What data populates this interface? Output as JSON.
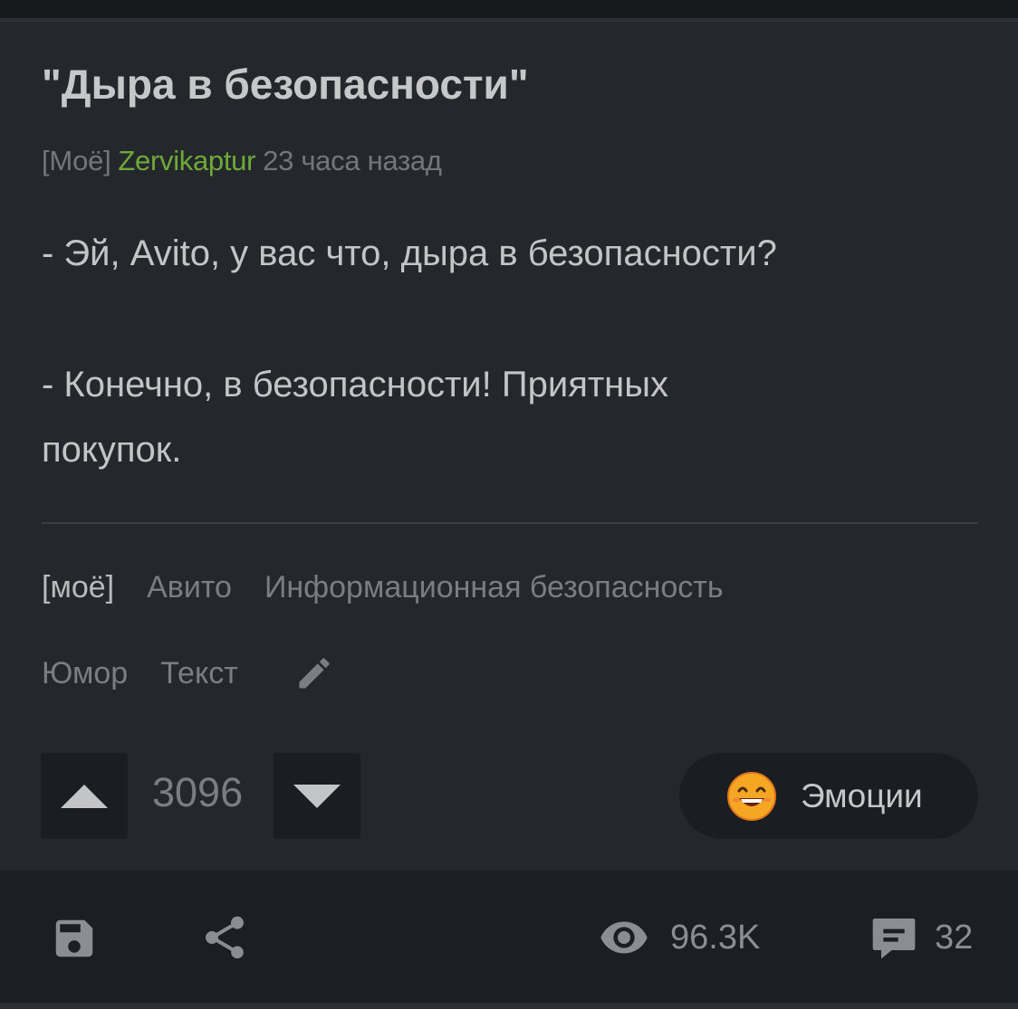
{
  "post": {
    "title": "\"Дыра в безопасности\"",
    "community": "[Моё]",
    "author": "Zervikaptur",
    "time": "23 часа назад",
    "body_lines": [
      "- Эй, Avito, у вас что, дыра в безопасности?",
      "- Конечно, в безопасности! Приятных",
      "покупок."
    ]
  },
  "tags": {
    "row1": [
      "[моё]",
      "Авито",
      "Информационная безопасность"
    ],
    "row2": [
      "Юмор",
      "Текст"
    ]
  },
  "votes": {
    "score": "3096"
  },
  "emotions": {
    "label": "Эмоции"
  },
  "stats": {
    "views": "96.3K",
    "comments": "32"
  },
  "icons": [
    "arrow-up-icon",
    "arrow-down-icon",
    "pencil-icon",
    "emoji-face-icon",
    "save-icon",
    "share-icon",
    "eye-icon",
    "comment-icon"
  ],
  "colors": {
    "background": "#1b1e22",
    "card": "#24272c",
    "author": "#6eaa38",
    "text": "#c3c4c6",
    "muted": "#7a7d82"
  }
}
